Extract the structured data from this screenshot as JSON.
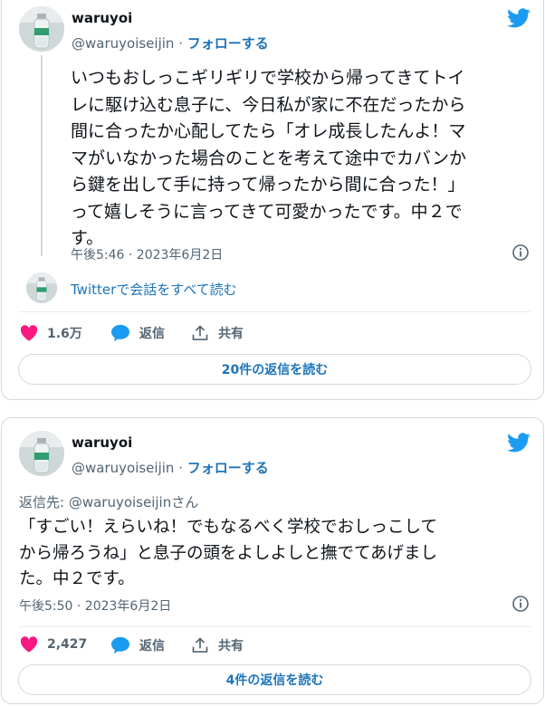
{
  "tweets": [
    {
      "author_name": "waruyoi",
      "author_handle": "@waruyoiseijin",
      "separator": "·",
      "follow_label": "フォローする",
      "text_lines": [
        "いつもおしっこギリギリで学校から帰ってきてトイ",
        "レに駆け込む息子に、今日私が家に不在だったから",
        "間に合ったか心配してたら「オレ成長したんよ！マ",
        "マがいなかった場合のことを考えて途中でカバンか",
        "ら鍵を出して手に持って帰ったから間に合った！」",
        "って嬉しそうに言ってきて可愛かったです。中２で",
        "す。"
      ],
      "timestamp": "午後5:46 · 2023年6月2日",
      "read_conversation": "Twitterで会話をすべて読む",
      "likes": "1.6万",
      "reply_label": "返信",
      "share_label": "共有",
      "replies_button": "20件の返信を読む",
      "icons": [
        "twitter-bird-icon",
        "info-icon",
        "heart-icon",
        "reply-bubble-icon",
        "share-icon"
      ],
      "colors": {
        "heart": "#f91880",
        "reply": "#1d9bf0",
        "link": "#1d74b9"
      }
    },
    {
      "author_name": "waruyoi",
      "author_handle": "@waruyoiseijin",
      "separator": "·",
      "follow_label": "フォローする",
      "reply_to": "返信先: @waruyoiseijinさん",
      "text_lines": [
        "「すごい！えらいね！でもなるべく学校でおしっこして",
        "から帰ろうね」と息子の頭をよしよしと撫でてあげまし",
        "た。中２です。"
      ],
      "timestamp": "午後5:50 · 2023年6月2日",
      "likes": "2,427",
      "reply_label": "返信",
      "share_label": "共有",
      "replies_button": "4件の返信を読む"
    }
  ]
}
